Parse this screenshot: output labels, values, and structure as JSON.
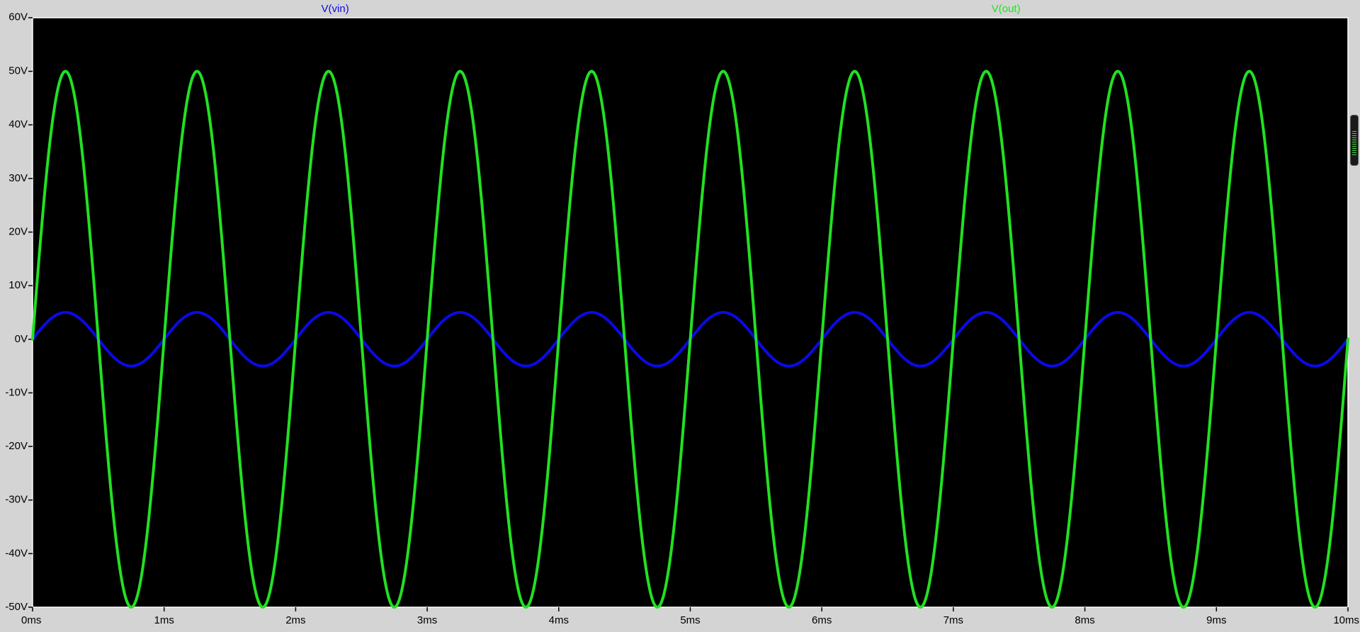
{
  "chart_data": {
    "type": "line",
    "title": "",
    "xlabel": "",
    "ylabel": "",
    "x_range": [
      0,
      10
    ],
    "x_unit": "ms",
    "xlim": [
      0,
      10
    ],
    "ylim": [
      -50,
      60
    ],
    "x_ticks": [
      "0ms",
      "1ms",
      "2ms",
      "3ms",
      "4ms",
      "5ms",
      "6ms",
      "7ms",
      "8ms",
      "9ms",
      "10ms"
    ],
    "y_ticks": [
      "60V",
      "50V",
      "40V",
      "30V",
      "20V",
      "10V",
      "0V",
      "-10V",
      "-20V",
      "-30V",
      "-40V",
      "-50V"
    ],
    "grid": false,
    "background": "#000000",
    "series": [
      {
        "name": "V(vin)",
        "color": "#0a0ae6",
        "waveform": "sine",
        "amplitude_V": 5,
        "frequency_kHz": 1,
        "offset_V": 0
      },
      {
        "name": "V(out)",
        "color": "#22e022",
        "waveform": "sine",
        "amplitude_V": 50,
        "frequency_kHz": 1,
        "offset_V": 0
      }
    ]
  }
}
